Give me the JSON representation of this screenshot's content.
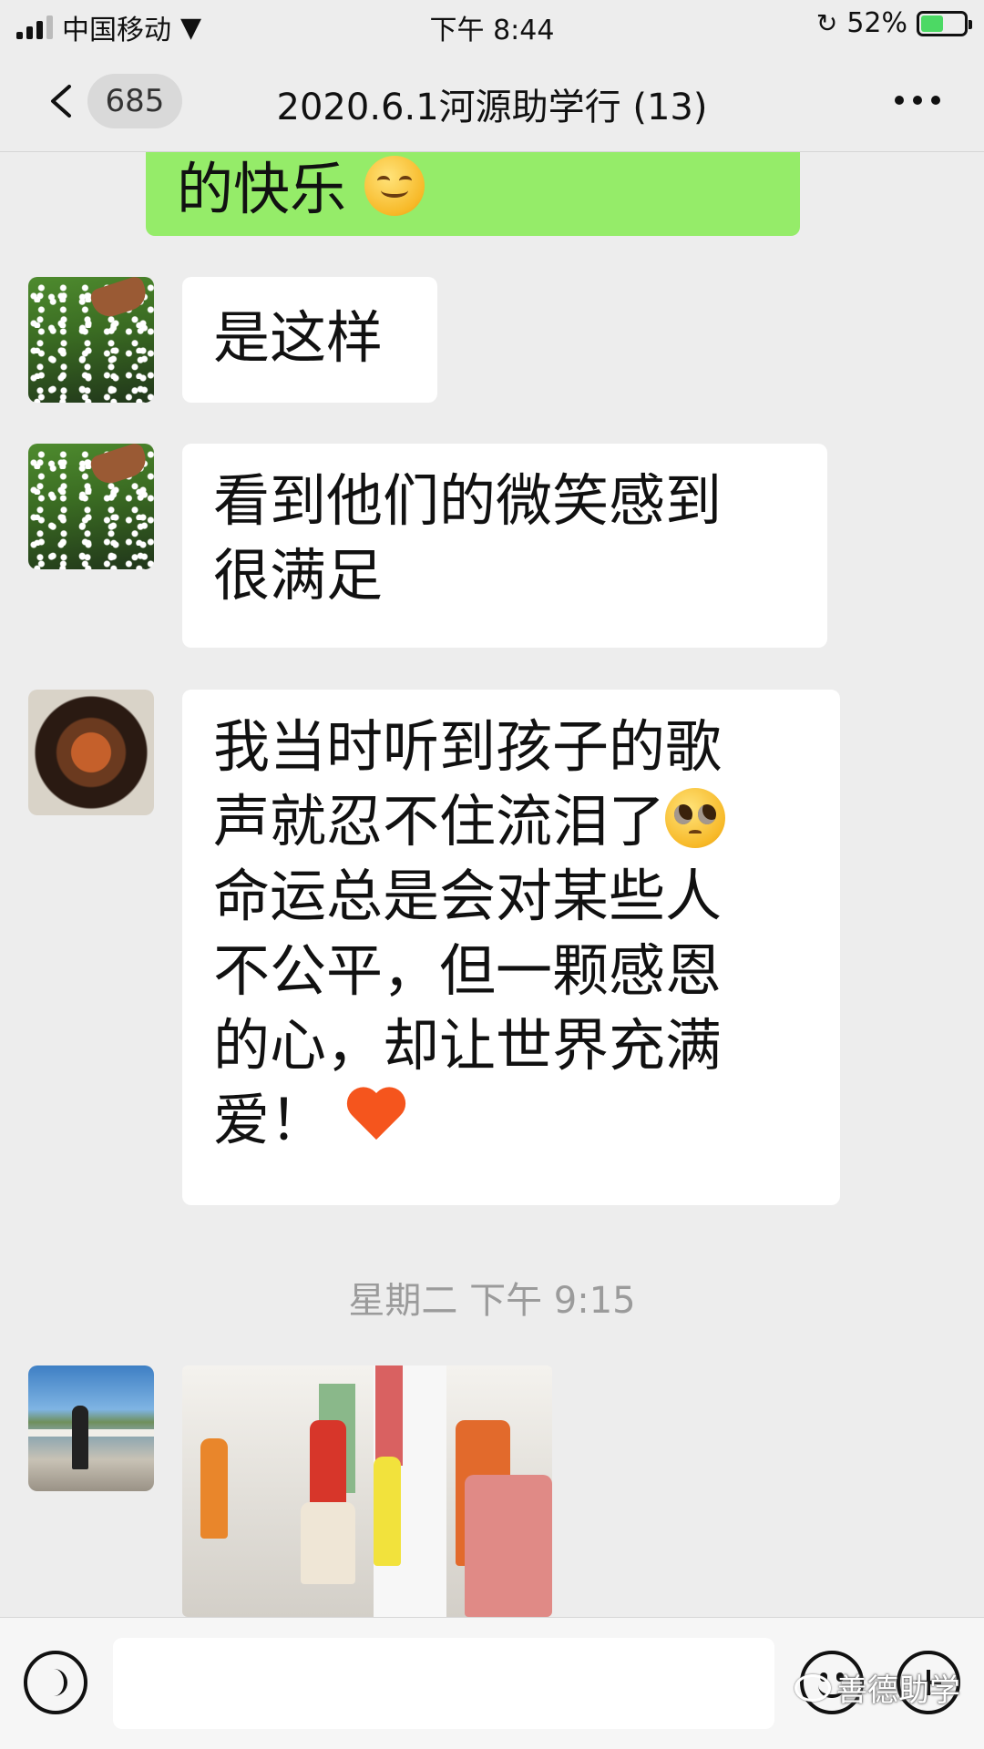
{
  "status_bar": {
    "carrier": "中国移动",
    "time": "下午 8:44",
    "battery_percent": "52%",
    "battery_level": 0.52
  },
  "nav": {
    "unread_count": "685",
    "title": "2020.6.1河源助学行 (13)"
  },
  "messages": [
    {
      "type": "text",
      "side": "right",
      "text": "的快乐",
      "emoji": "smiling-face-icon"
    },
    {
      "type": "text",
      "side": "left",
      "avatar": "grass-flowers-avatar",
      "text": "是这样"
    },
    {
      "type": "text",
      "side": "left",
      "avatar": "grass-flowers-avatar",
      "lines": [
        "看到他们的微笑感到",
        "很满足"
      ]
    },
    {
      "type": "text",
      "side": "left",
      "avatar": "wooden-carving-avatar",
      "lines": [
        "我当时听到孩子的歌",
        "声就忍不住流泪了",
        "命运总是会对某些人",
        "不公平，但一颗感恩",
        "的心，却让世界充满",
        "爱！"
      ],
      "emojis": [
        "pleading-face-icon",
        "orange-heart-icon"
      ]
    },
    {
      "type": "timestamp",
      "text": "星期二 下午 9:15"
    },
    {
      "type": "image",
      "side": "left",
      "avatar": "seaside-person-avatar",
      "description_icon": "hallway-photo"
    }
  ],
  "input_bar": {
    "placeholder": ""
  },
  "watermark": {
    "text": "善德助学"
  },
  "colors": {
    "background": "#ededed",
    "sent_bubble": "#95ec69",
    "received_bubble": "#ffffff",
    "timestamp": "#9b9b9b"
  }
}
